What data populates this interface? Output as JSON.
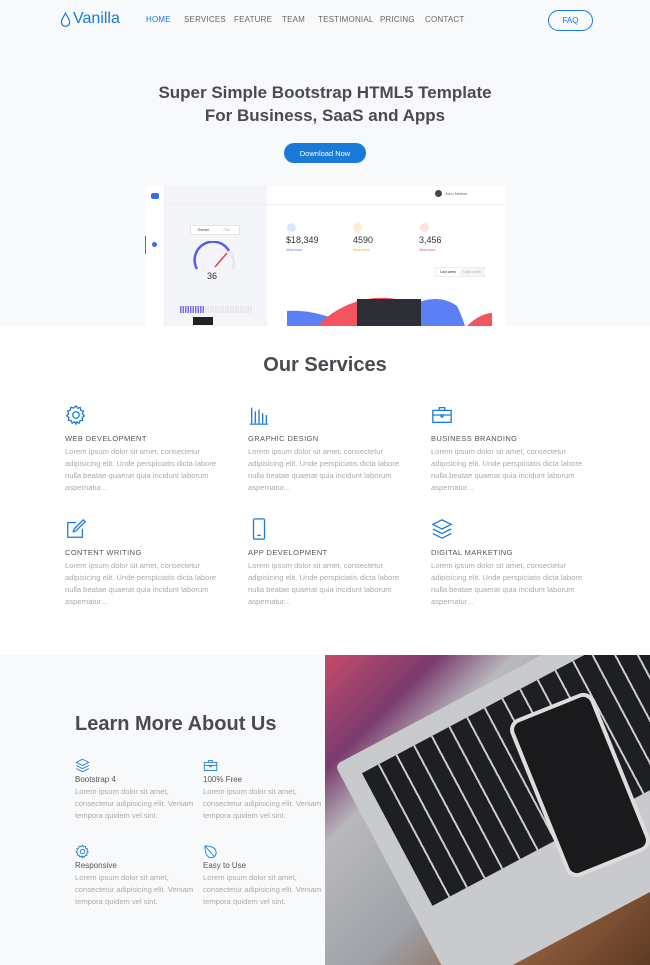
{
  "nav": {
    "brand": "Vanilla",
    "items": [
      "HOME",
      "SERVICES",
      "FEATURE",
      "TEAM",
      "TESTIMONIAL",
      "PRICING",
      "CONTACT"
    ],
    "active": "HOME",
    "faq": "FAQ"
  },
  "hero": {
    "line1": "Super Simple Bootstrap HTML5 Template",
    "line2": "For Business, SaaS and Apps",
    "button": "Download Now"
  },
  "dashboard": {
    "tabs": [
      "Overall",
      "Plan"
    ],
    "gauge_value": "36",
    "stats": [
      {
        "value": "$18,349",
        "link": "View more",
        "color": "#4a7bf7"
      },
      {
        "value": "4590",
        "link": "View more",
        "color": "#f0a020"
      },
      {
        "value": "3,456",
        "link": "View more",
        "color": "#f04545"
      }
    ],
    "range_tabs": [
      "Last week",
      "Last month"
    ],
    "user": "John Nelson"
  },
  "services": {
    "title": "Our Services",
    "items": [
      {
        "icon": "gear-icon",
        "title": "WEB DEVELOPMENT",
        "text": "Lorem ipsum dolor sit amet, consectetur adipisicing elit. Unde perspiciatis dicta labore nulla beatae quaerat quia incidunt laborum aspernatur..."
      },
      {
        "icon": "bar-chart-icon",
        "title": "GRAPHIC DESIGN",
        "text": "Lorem ipsum dolor sit amet, consectetur adipisicing elit. Unde perspiciatis dicta labore nulla beatae quaerat quia incidunt laborum aspernatur..."
      },
      {
        "icon": "briefcase-icon",
        "title": "BUSINESS BRANDING",
        "text": "Lorem ipsum dolor sit amet, consectetur adipisicing elit. Unde perspiciatis dicta labore nulla beatae quaerat quia incidunt laborum aspernatur..."
      },
      {
        "icon": "edit-icon",
        "title": "CONTENT WRITING",
        "text": "Lorem ipsum dolor sit amet, consectetur adipisicing elit. Unde perspiciatis dicta labore nulla beatae quaerat quia incidunt laborum aspernatur..."
      },
      {
        "icon": "mobile-icon",
        "title": "APP DEVELOPMENT",
        "text": "Lorem ipsum dolor sit amet, consectetur adipisicing elit. Unde perspiciatis dicta labore nulla beatae quaerat quia incidunt laborum aspernatur..."
      },
      {
        "icon": "layers-icon",
        "title": "DIGITAL MARKETING",
        "text": "Lorem ipsum dolor sit amet, consectetur adipisicing elit. Unde perspiciatis dicta labore nulla beatae quaerat quia incidunt laborum aspernatur..."
      }
    ]
  },
  "about": {
    "title": "Learn More About Us",
    "items": [
      {
        "icon": "layers-icon",
        "title": "Bootstrap 4",
        "text": "Lorem ipsum dolor sit amet, consectetur adipisicing elit. Veniam tempora quidem vel sint."
      },
      {
        "icon": "briefcase-icon",
        "title": "100% Free",
        "text": "Lorem ipsum dolor sit amet, consectetur adipisicing elit. Veniam tempora quidem vel sint."
      },
      {
        "icon": "gear-icon",
        "title": "Responsive",
        "text": "Lorem ipsum dolor sit amet, consectetur adipisicing elit. Veniam tempora quidem vel sint."
      },
      {
        "icon": "leaf-icon",
        "title": "Easy to Use",
        "text": "Lorem ipsum dolor sit amet, consectetur adipisicing elit. Veniam tempora quidem vel sint."
      }
    ]
  },
  "colors": {
    "accent": "#1a7ad9",
    "heading": "#4a4a52"
  }
}
